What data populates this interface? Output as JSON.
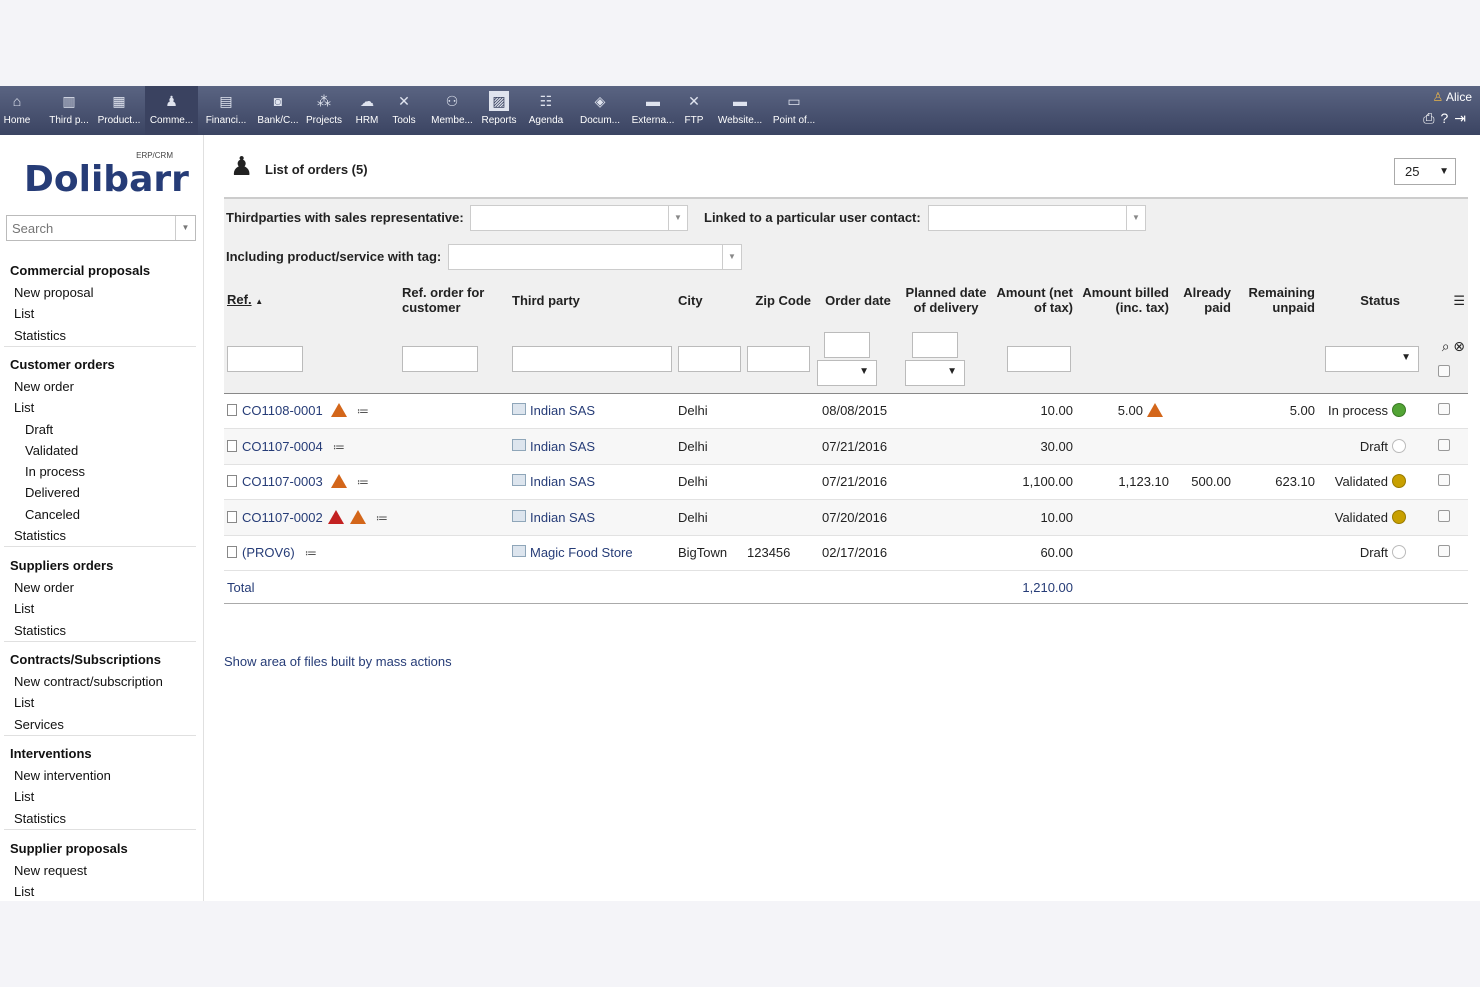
{
  "topbar": {
    "menu": [
      {
        "label": "Home",
        "icon": "home-icon"
      },
      {
        "label": "Third p...",
        "icon": "company-icon"
      },
      {
        "label": "Product...",
        "icon": "product-icon"
      },
      {
        "label": "Comme...",
        "icon": "commercial-icon"
      },
      {
        "label": "Financi...",
        "icon": "billing-icon"
      },
      {
        "label": "Bank/C...",
        "icon": "bank-icon"
      },
      {
        "label": "Projects",
        "icon": "project-icon"
      },
      {
        "label": "HRM",
        "icon": "hrm-icon"
      },
      {
        "label": "Tools",
        "icon": "tools-icon"
      },
      {
        "label": "Membe...",
        "icon": "members-icon"
      },
      {
        "label": "Reports",
        "icon": "reports-icon"
      },
      {
        "label": "Agenda",
        "icon": "agenda-icon"
      },
      {
        "label": "Docum...",
        "icon": "documents-icon"
      },
      {
        "label": "Externa...",
        "icon": "external-icon"
      },
      {
        "label": "FTP",
        "icon": "ftp-icon"
      },
      {
        "label": "Website...",
        "icon": "website-icon"
      },
      {
        "label": "Point of...",
        "icon": "pos-icon"
      }
    ],
    "user_name": "Alice"
  },
  "sidebar": {
    "logo_main": "Dolibarr",
    "logo_sub": "ERP/CRM",
    "search_placeholder": "Search",
    "sections": [
      {
        "title": "Commercial proposals",
        "links": [
          "New proposal",
          "List",
          "Statistics"
        ]
      },
      {
        "title": "Customer orders",
        "links": [
          "New order",
          "List",
          "Draft",
          "Validated",
          "In process",
          "Delivered",
          "Canceled",
          "Statistics"
        ]
      },
      {
        "title": "Suppliers orders",
        "links": [
          "New order",
          "List",
          "Statistics"
        ]
      },
      {
        "title": "Contracts/Subscriptions",
        "links": [
          "New contract/subscription",
          "List",
          "Services"
        ]
      },
      {
        "title": "Interventions",
        "links": [
          "New intervention",
          "List",
          "Statistics"
        ]
      },
      {
        "title": "Supplier proposals",
        "links": [
          "New request",
          "List"
        ]
      }
    ]
  },
  "main": {
    "title": "List of orders (5)",
    "limit": "25",
    "filters": {
      "sales_rep_label": "Thirdparties with sales representative:",
      "user_contact_label": "Linked to a particular user contact:",
      "product_tag_label": "Including product/service with tag:"
    },
    "columns": {
      "ref": "Ref.",
      "ref_customer": "Ref. order for customer",
      "third_party": "Third party",
      "city": "City",
      "zip": "Zip Code",
      "order_date": "Order date",
      "planned_delivery": "Planned date of delivery",
      "amount_net": "Amount (net of tax)",
      "amount_billed": "Amount billed (inc. tax)",
      "already_paid": "Already paid",
      "remaining_unpaid": "Remaining unpaid",
      "status": "Status"
    },
    "rows": [
      {
        "ref": "CO1108-0001",
        "third_party": "Indian SAS",
        "city": "Delhi",
        "zip": "",
        "order_date": "08/08/2015",
        "amount_net": "10.00",
        "amount_billed": "5.00",
        "already_paid": "",
        "remaining_unpaid": "5.00",
        "status": "In process"
      },
      {
        "ref": "CO1107-0004",
        "third_party": "Indian SAS",
        "city": "Delhi",
        "zip": "",
        "order_date": "07/21/2016",
        "amount_net": "30.00",
        "amount_billed": "",
        "already_paid": "",
        "remaining_unpaid": "",
        "status": "Draft"
      },
      {
        "ref": "CO1107-0003",
        "third_party": "Indian SAS",
        "city": "Delhi",
        "zip": "",
        "order_date": "07/21/2016",
        "amount_net": "1,100.00",
        "amount_billed": "1,123.10",
        "already_paid": "500.00",
        "remaining_unpaid": "623.10",
        "status": "Validated"
      },
      {
        "ref": "CO1107-0002",
        "third_party": "Indian SAS",
        "city": "Delhi",
        "zip": "",
        "order_date": "07/20/2016",
        "amount_net": "10.00",
        "amount_billed": "",
        "already_paid": "",
        "remaining_unpaid": "",
        "status": "Validated"
      },
      {
        "ref": "(PROV6)",
        "third_party": "Magic Food Store",
        "city": "BigTown",
        "zip": "123456",
        "order_date": "02/17/2016",
        "amount_net": "60.00",
        "amount_billed": "",
        "already_paid": "",
        "remaining_unpaid": "",
        "status": "Draft"
      }
    ],
    "total_label": "Total",
    "total_amount": "1,210.00",
    "mass_actions_link": "Show area of files built by mass actions"
  },
  "colors": {
    "accent": "#263c77",
    "topbar": "#4a5372",
    "status_in_process": "#52a435",
    "status_validated": "#c8a000"
  }
}
